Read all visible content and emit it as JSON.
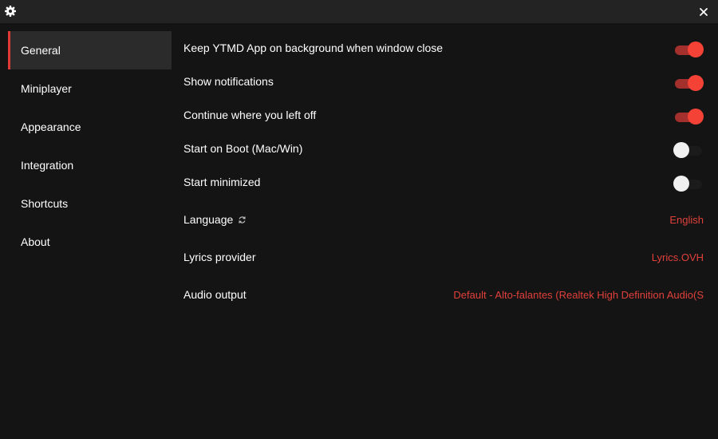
{
  "titlebar": {
    "settings_icon": "gear-icon",
    "close_icon": "close-icon",
    "close_glyph": "✕"
  },
  "sidebar": {
    "items": [
      {
        "label": "General",
        "active": true
      },
      {
        "label": "Miniplayer",
        "active": false
      },
      {
        "label": "Appearance",
        "active": false
      },
      {
        "label": "Integration",
        "active": false
      },
      {
        "label": "Shortcuts",
        "active": false
      },
      {
        "label": "About",
        "active": false
      }
    ]
  },
  "general": {
    "toggles": [
      {
        "label": "Keep YTMD App on background when window close",
        "on": true
      },
      {
        "label": "Show notifications",
        "on": true
      },
      {
        "label": "Continue where you left off",
        "on": true
      },
      {
        "label": "Start on Boot (Mac/Win)",
        "on": false
      },
      {
        "label": "Start minimized",
        "on": false
      }
    ],
    "language": {
      "label": "Language",
      "value": "English",
      "icon": "refresh-icon"
    },
    "lyrics": {
      "label": "Lyrics provider",
      "value": "Lyrics.OVH"
    },
    "audio": {
      "label": "Audio output",
      "value": "Default - Alto-falantes (Realtek High Definition Audio(S"
    }
  },
  "colors": {
    "accent": "#f44336",
    "accent_track": "#a4302d",
    "value_text": "#e0403b",
    "background": "#141414",
    "titlebar": "#232323",
    "active_nav": "#2b2b2b"
  }
}
